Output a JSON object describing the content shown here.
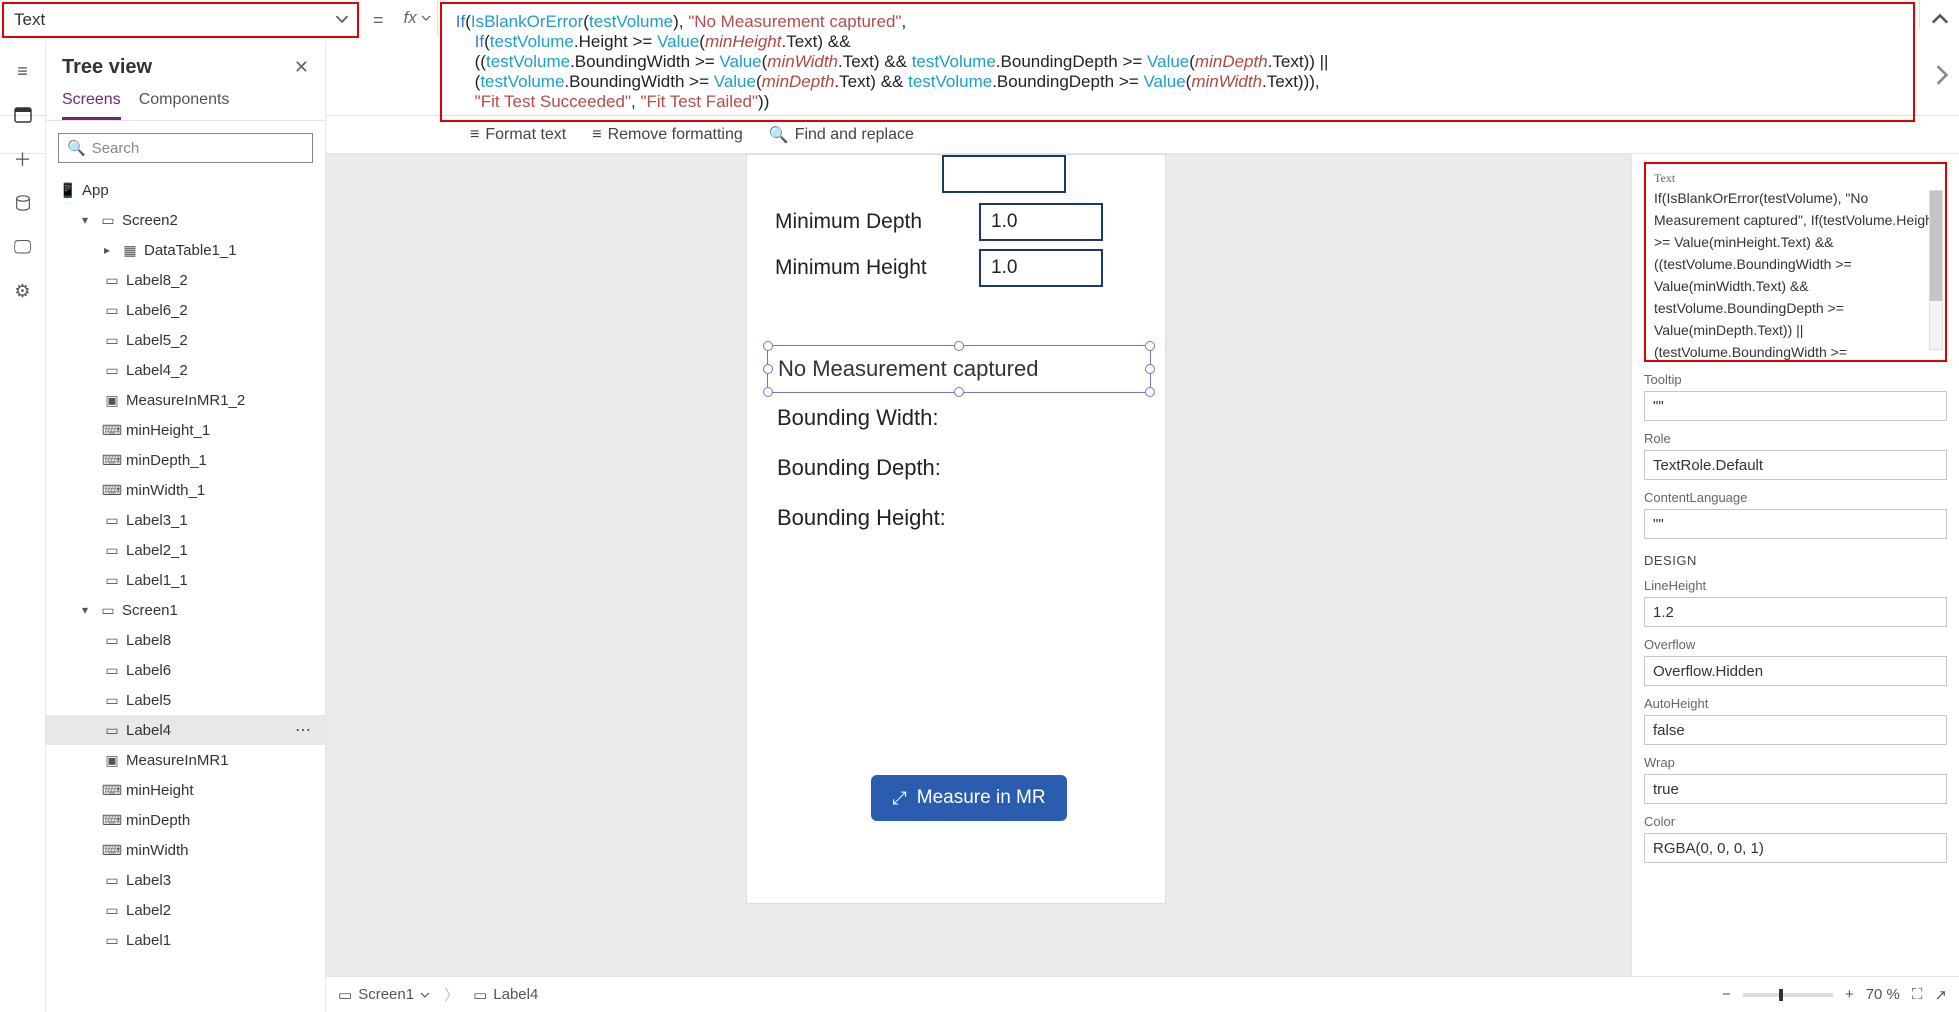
{
  "propertySelector": "Text",
  "formula_lines": [
    [
      {
        "t": "If",
        "c": "kw"
      },
      {
        "t": "(",
        "c": "tok"
      },
      {
        "t": "IsBlankOrError",
        "c": "fn"
      },
      {
        "t": "(",
        "c": "tok"
      },
      {
        "t": "testVolume",
        "c": "id"
      },
      {
        "t": "), ",
        "c": "tok"
      },
      {
        "t": "\"No Measurement captured\"",
        "c": "str"
      },
      {
        "t": ",",
        "c": "tok"
      }
    ],
    [
      {
        "t": "    ",
        "c": "tok"
      },
      {
        "t": "If",
        "c": "kw"
      },
      {
        "t": "(",
        "c": "tok"
      },
      {
        "t": "testVolume",
        "c": "id"
      },
      {
        "t": ".Height >= ",
        "c": "tok"
      },
      {
        "t": "Value",
        "c": "fn"
      },
      {
        "t": "(",
        "c": "tok"
      },
      {
        "t": "minHeight",
        "c": "var"
      },
      {
        "t": ".Text) &&",
        "c": "tok"
      }
    ],
    [
      {
        "t": "    ((",
        "c": "tok"
      },
      {
        "t": "testVolume",
        "c": "id"
      },
      {
        "t": ".BoundingWidth >= ",
        "c": "tok"
      },
      {
        "t": "Value",
        "c": "fn"
      },
      {
        "t": "(",
        "c": "tok"
      },
      {
        "t": "minWidth",
        "c": "var"
      },
      {
        "t": ".Text) && ",
        "c": "tok"
      },
      {
        "t": "testVolume",
        "c": "id"
      },
      {
        "t": ".BoundingDepth >= ",
        "c": "tok"
      },
      {
        "t": "Value",
        "c": "fn"
      },
      {
        "t": "(",
        "c": "tok"
      },
      {
        "t": "minDepth",
        "c": "var"
      },
      {
        "t": ".Text)) ||",
        "c": "tok"
      }
    ],
    [
      {
        "t": "    (",
        "c": "tok"
      },
      {
        "t": "testVolume",
        "c": "id"
      },
      {
        "t": ".BoundingWidth >= ",
        "c": "tok"
      },
      {
        "t": "Value",
        "c": "fn"
      },
      {
        "t": "(",
        "c": "tok"
      },
      {
        "t": "minDepth",
        "c": "var"
      },
      {
        "t": ".Text) && ",
        "c": "tok"
      },
      {
        "t": "testVolume",
        "c": "id"
      },
      {
        "t": ".BoundingDepth >= ",
        "c": "tok"
      },
      {
        "t": "Value",
        "c": "fn"
      },
      {
        "t": "(",
        "c": "tok"
      },
      {
        "t": "minWidth",
        "c": "var"
      },
      {
        "t": ".Text))),",
        "c": "tok"
      }
    ],
    [
      {
        "t": "    ",
        "c": "tok"
      },
      {
        "t": "\"Fit Test Succeeded\"",
        "c": "str"
      },
      {
        "t": ", ",
        "c": "tok"
      },
      {
        "t": "\"Fit Test Failed\"",
        "c": "str"
      },
      {
        "t": "))",
        "c": "tok"
      }
    ]
  ],
  "toolbar2": {
    "format": "Format text",
    "remove": "Remove formatting",
    "find": "Find and replace"
  },
  "tree": {
    "title": "Tree view",
    "tabs": {
      "screens": "Screens",
      "components": "Components"
    },
    "searchPlaceholder": "Search",
    "app": "App",
    "nodes": [
      {
        "lvl": 2,
        "exp": "▾",
        "ico": "screen",
        "label": "Screen2"
      },
      {
        "lvl": 3,
        "exp": "▸",
        "ico": "table",
        "label": "DataTable1_1"
      },
      {
        "lvl": 3,
        "exp": "",
        "ico": "label",
        "label": "Label8_2"
      },
      {
        "lvl": 3,
        "exp": "",
        "ico": "label",
        "label": "Label6_2"
      },
      {
        "lvl": 3,
        "exp": "",
        "ico": "label",
        "label": "Label5_2"
      },
      {
        "lvl": 3,
        "exp": "",
        "ico": "label",
        "label": "Label4_2"
      },
      {
        "lvl": 3,
        "exp": "",
        "ico": "mr",
        "label": "MeasureInMR1_2"
      },
      {
        "lvl": 3,
        "exp": "",
        "ico": "input",
        "label": "minHeight_1"
      },
      {
        "lvl": 3,
        "exp": "",
        "ico": "input",
        "label": "minDepth_1"
      },
      {
        "lvl": 3,
        "exp": "",
        "ico": "input",
        "label": "minWidth_1"
      },
      {
        "lvl": 3,
        "exp": "",
        "ico": "label",
        "label": "Label3_1"
      },
      {
        "lvl": 3,
        "exp": "",
        "ico": "label",
        "label": "Label2_1"
      },
      {
        "lvl": 3,
        "exp": "",
        "ico": "label",
        "label": "Label1_1"
      },
      {
        "lvl": 2,
        "exp": "▾",
        "ico": "screen",
        "label": "Screen1"
      },
      {
        "lvl": 3,
        "exp": "",
        "ico": "label",
        "label": "Label8"
      },
      {
        "lvl": 3,
        "exp": "",
        "ico": "label",
        "label": "Label6"
      },
      {
        "lvl": 3,
        "exp": "",
        "ico": "label",
        "label": "Label5"
      },
      {
        "lvl": 3,
        "exp": "",
        "ico": "label",
        "label": "Label4",
        "sel": true
      },
      {
        "lvl": 3,
        "exp": "",
        "ico": "mr",
        "label": "MeasureInMR1"
      },
      {
        "lvl": 3,
        "exp": "",
        "ico": "input",
        "label": "minHeight"
      },
      {
        "lvl": 3,
        "exp": "",
        "ico": "input",
        "label": "minDepth"
      },
      {
        "lvl": 3,
        "exp": "",
        "ico": "input",
        "label": "minWidth"
      },
      {
        "lvl": 3,
        "exp": "",
        "ico": "label",
        "label": "Label3"
      },
      {
        "lvl": 3,
        "exp": "",
        "ico": "label",
        "label": "Label2"
      },
      {
        "lvl": 3,
        "exp": "",
        "ico": "label",
        "label": "Label1"
      }
    ]
  },
  "canvas": {
    "minDepthLabel": "Minimum Depth",
    "minHeightLabel": "Minimum Height",
    "minDepthVal": "1.0",
    "minHeightVal": "1.0",
    "noMeasure": "No Measurement captured",
    "bWidth": "Bounding Width:",
    "bDepth": "Bounding Depth:",
    "bHeight": "Bounding Height:",
    "button": "Measure in MR"
  },
  "props": {
    "textLabel": "Text",
    "textValue": "If(IsBlankOrError(testVolume), \"No Measurement captured\",\nIf(testVolume.Height >= Value(minHeight.Text) && ((testVolume.BoundingWidth >= Value(minWidth.Text) && testVolume.BoundingDepth >= Value(minDepth.Text)) || (testVolume.BoundingWidth >= Value(minDepth.Text) &&",
    "tooltipLabel": "Tooltip",
    "tooltipValue": "\"\"",
    "roleLabel": "Role",
    "roleValue": "TextRole.Default",
    "langLabel": "ContentLanguage",
    "langValue": "\"\"",
    "designLabel": "DESIGN",
    "lhLabel": "LineHeight",
    "lhValue": "1.2",
    "ovLabel": "Overflow",
    "ovValue": "Overflow.Hidden",
    "ahLabel": "AutoHeight",
    "ahValue": "false",
    "wrapLabel": "Wrap",
    "wrapValue": "true",
    "colorLabel": "Color",
    "colorValue": "RGBA(0, 0, 0, 1)"
  },
  "bottom": {
    "crumb1": "Screen1",
    "crumb2": "Label4",
    "zoom": "70 %"
  }
}
